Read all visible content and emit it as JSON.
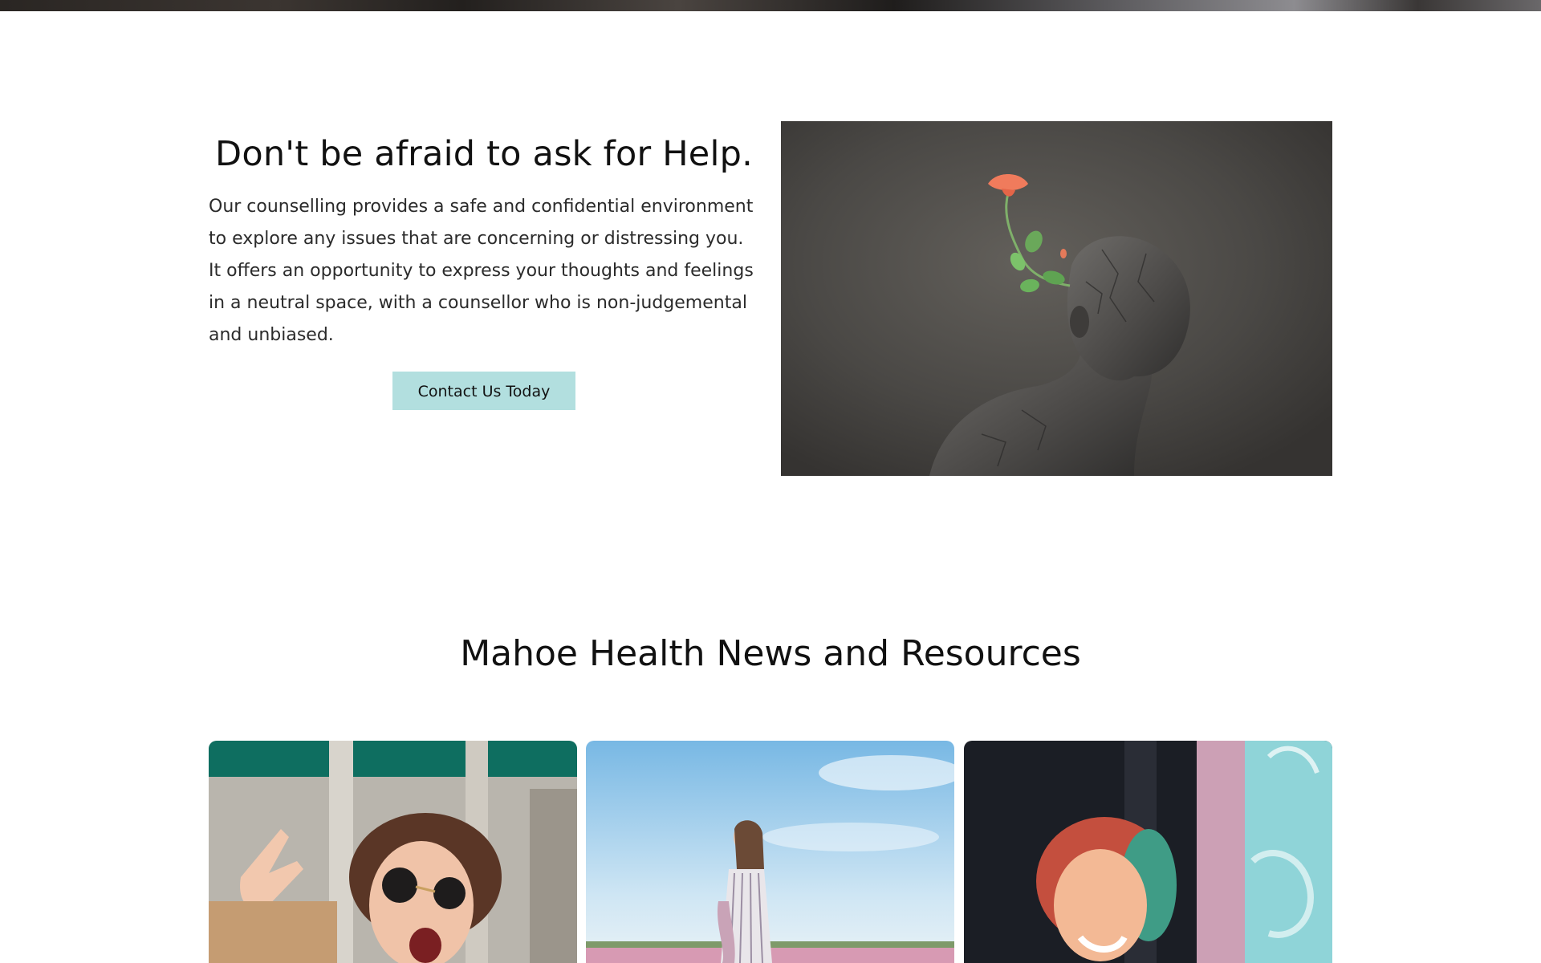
{
  "help_section": {
    "title": "Don't be afraid to ask for Help.",
    "body": "Our counselling provides a safe and confidential environment to explore any issues that are concerning or distressing you. It offers an opportunity to express your thoughts and feelings in a neutral space, with a counsellor who is non-judgemental and unbiased.",
    "button_label": "Contact Us Today",
    "button_color": "#b2dfdf",
    "image": "stone-head-with-flower-image"
  },
  "news_section": {
    "title": "Mahoe Health News and Resources",
    "cards": [
      {
        "image": "woman-sunglasses-peace-sign-image"
      },
      {
        "image": "woman-in-flower-field-image"
      },
      {
        "image": "woman-neon-light-image"
      }
    ]
  },
  "header_strip": {
    "image": "hero-photo-bottom-edge"
  }
}
